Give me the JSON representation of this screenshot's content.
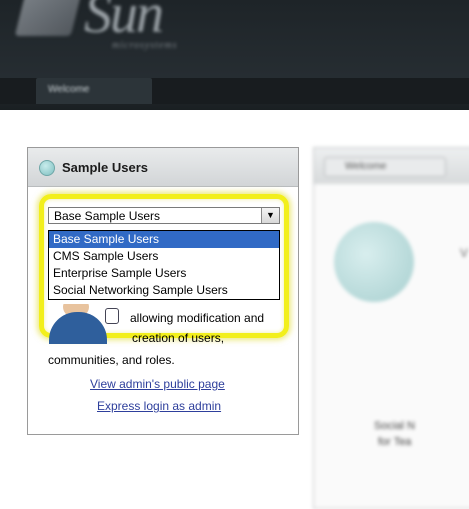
{
  "header": {
    "logo_text": "Sun",
    "logo_subtext": "microsystems",
    "nav_tab_label": "Welcome"
  },
  "portlet": {
    "title": "Sample Users",
    "select": {
      "value": "Base Sample Users",
      "arrow": "▼",
      "options": [
        "Base Sample Users",
        "CMS Sample Users",
        "Enterprise Sample Users",
        "Social Networking Sample Users"
      ],
      "selected_index": 0
    },
    "body_lines": [
      "allowing modification and",
      "creation of users,",
      "communities, and roles."
    ],
    "links": [
      "View admin's public page",
      "Express login as admin"
    ]
  },
  "right_portlet": {
    "tab_label": "Welcome",
    "text_line1": "Social N",
    "text_line2": "for Tea",
    "partial_letter": "V"
  },
  "colors": {
    "highlight": "#f2ef1c",
    "selected_option": "#316ac5",
    "link": "#2e3f9c",
    "header_bg": "#262d32"
  }
}
